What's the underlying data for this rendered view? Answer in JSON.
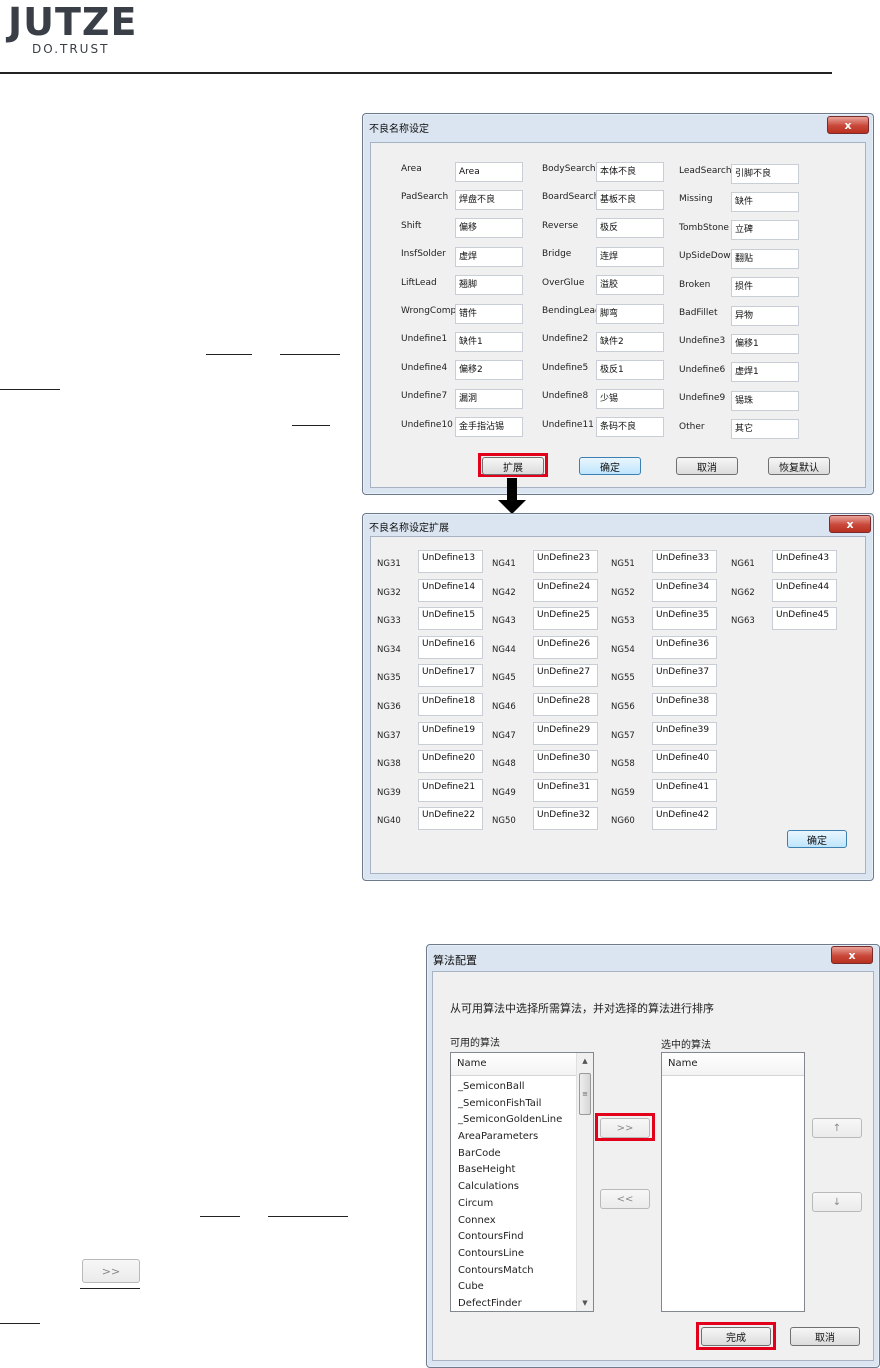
{
  "header": {
    "logo_main": "JUTZE",
    "logo_sub": "DO.TRUST"
  },
  "defect_dialog": {
    "title": "不良名称设定",
    "close_glyph": "x",
    "rows": [
      [
        {
          "label": "Area",
          "value": "Area"
        },
        {
          "label": "BodySearch",
          "value": "本体不良"
        },
        {
          "label": "LeadSearch",
          "value": "引脚不良"
        }
      ],
      [
        {
          "label": "PadSearch",
          "value": "焊盘不良"
        },
        {
          "label": "BoardSearch",
          "value": "基板不良"
        },
        {
          "label": "Missing",
          "value": "缺件"
        }
      ],
      [
        {
          "label": "Shift",
          "value": "偏移"
        },
        {
          "label": "Reverse",
          "value": "极反"
        },
        {
          "label": "TombStone",
          "value": "立碑"
        }
      ],
      [
        {
          "label": "InsfSolder",
          "value": "虚焊"
        },
        {
          "label": "Bridge",
          "value": "连焊"
        },
        {
          "label": "UpSideDown",
          "value": "翻贴"
        }
      ],
      [
        {
          "label": "LiftLead",
          "value": "翘脚"
        },
        {
          "label": "OverGlue",
          "value": "溢胶"
        },
        {
          "label": "Broken",
          "value": "损件"
        }
      ],
      [
        {
          "label": "WrongComp",
          "value": "错件"
        },
        {
          "label": "BendingLead",
          "value": "脚弯"
        },
        {
          "label": "BadFillet",
          "value": "异物"
        }
      ],
      [
        {
          "label": "Undefine1",
          "value": "缺件1"
        },
        {
          "label": "Undefine2",
          "value": "缺件2"
        },
        {
          "label": "Undefine3",
          "value": "偏移1"
        }
      ],
      [
        {
          "label": "Undefine4",
          "value": "偏移2"
        },
        {
          "label": "Undefine5",
          "value": "极反1"
        },
        {
          "label": "Undefine6",
          "value": "虚焊1"
        }
      ],
      [
        {
          "label": "Undefine7",
          "value": "漏洞"
        },
        {
          "label": "Undefine8",
          "value": "少锡"
        },
        {
          "label": "Undefine9",
          "value": "锡珠"
        }
      ],
      [
        {
          "label": "Undefine10",
          "value": "金手指沾锡"
        },
        {
          "label": "Undefine11",
          "value": "条码不良"
        },
        {
          "label": "Other",
          "value": "其它"
        }
      ]
    ],
    "buttons": {
      "expand": "扩展",
      "ok": "确定",
      "cancel": "取消",
      "restore": "恢复默认"
    }
  },
  "ext_dialog": {
    "title": "不良名称设定扩展",
    "col1": [
      {
        "label": "NG31",
        "value": "UnDefine13"
      },
      {
        "label": "NG32",
        "value": "UnDefine14"
      },
      {
        "label": "NG33",
        "value": "UnDefine15"
      },
      {
        "label": "NG34",
        "value": "UnDefine16"
      },
      {
        "label": "NG35",
        "value": "UnDefine17"
      },
      {
        "label": "NG36",
        "value": "UnDefine18"
      },
      {
        "label": "NG37",
        "value": "UnDefine19"
      },
      {
        "label": "NG38",
        "value": "UnDefine20"
      },
      {
        "label": "NG39",
        "value": "UnDefine21"
      },
      {
        "label": "NG40",
        "value": "UnDefine22"
      }
    ],
    "col2": [
      {
        "label": "NG41",
        "value": "UnDefine23"
      },
      {
        "label": "NG42",
        "value": "UnDefine24"
      },
      {
        "label": "NG43",
        "value": "UnDefine25"
      },
      {
        "label": "NG44",
        "value": "UnDefine26"
      },
      {
        "label": "NG45",
        "value": "UnDefine27"
      },
      {
        "label": "NG46",
        "value": "UnDefine28"
      },
      {
        "label": "NG47",
        "value": "UnDefine29"
      },
      {
        "label": "NG48",
        "value": "UnDefine30"
      },
      {
        "label": "NG49",
        "value": "UnDefine31"
      },
      {
        "label": "NG50",
        "value": "UnDefine32"
      }
    ],
    "col3": [
      {
        "label": "NG51",
        "value": "UnDefine33"
      },
      {
        "label": "NG52",
        "value": "UnDefine34"
      },
      {
        "label": "NG53",
        "value": "UnDefine35"
      },
      {
        "label": "NG54",
        "value": "UnDefine36"
      },
      {
        "label": "NG55",
        "value": "UnDefine37"
      },
      {
        "label": "NG56",
        "value": "UnDefine38"
      },
      {
        "label": "NG57",
        "value": "UnDefine39"
      },
      {
        "label": "NG58",
        "value": "UnDefine40"
      },
      {
        "label": "NG59",
        "value": "UnDefine41"
      },
      {
        "label": "NG60",
        "value": "UnDefine42"
      }
    ],
    "col4": [
      {
        "label": "NG61",
        "value": "UnDefine43"
      },
      {
        "label": "NG62",
        "value": "UnDefine44"
      },
      {
        "label": "NG63",
        "value": "UnDefine45"
      }
    ],
    "ok": "确定"
  },
  "algo_dialog": {
    "title": "算法配置",
    "instruction": "从可用算法中选择所需算法，并对选择的算法进行排序",
    "available_label": "可用的算法",
    "selected_label": "选中的算法",
    "column_name": "Name",
    "available_items": [
      "_SemiconBall",
      "_SemiconFishTail",
      "_SemiconGoldenLine",
      "AreaParameters",
      "BarCode",
      "BaseHeight",
      "Calculations",
      "Circum",
      "Connex",
      "ContoursFind",
      "ContoursLine",
      "ContoursMatch",
      "Cube",
      "DefectFinder"
    ],
    "add_button": ">>",
    "remove_button": "<<",
    "up_button": "↑",
    "down_button": "↓",
    "finish": "完成",
    "cancel": "取消"
  },
  "side_button": ">>"
}
